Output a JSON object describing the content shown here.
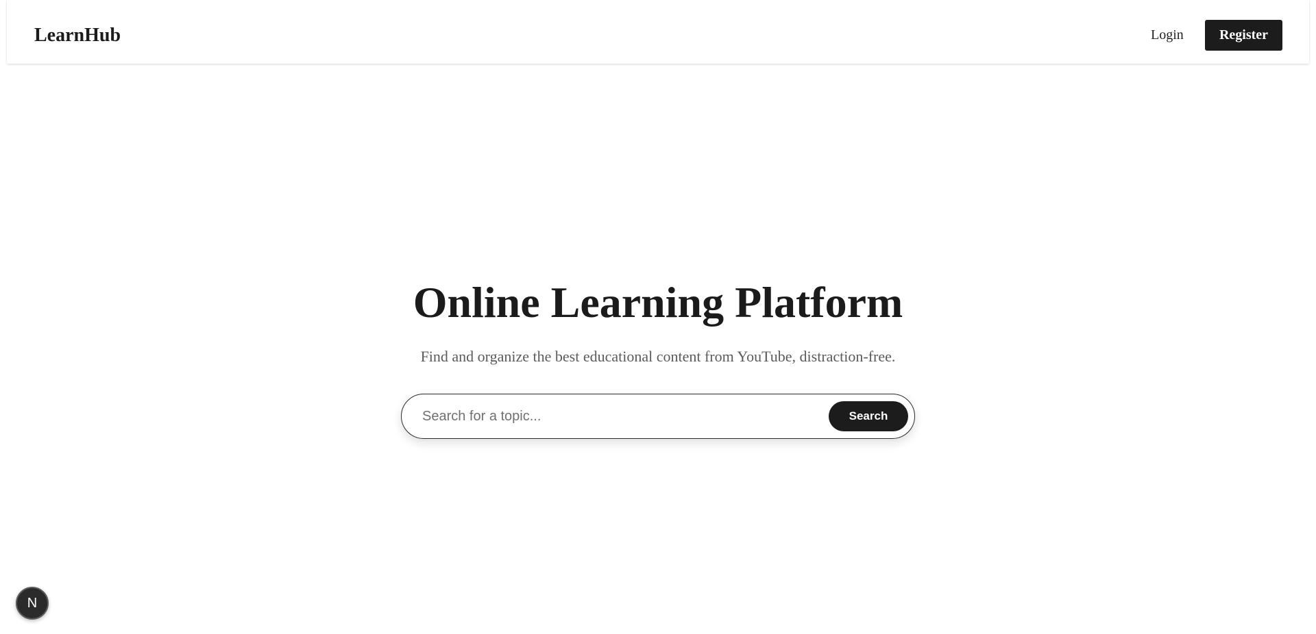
{
  "header": {
    "brand": "LearnHub",
    "login_label": "Login",
    "register_label": "Register"
  },
  "hero": {
    "title": "Online Learning Platform",
    "subtitle": "Find and organize the best educational content from YouTube, distraction-free."
  },
  "search": {
    "placeholder": "Search for a topic...",
    "value": "",
    "button_label": "Search"
  },
  "dev_badge": {
    "letter": "N",
    "icon": "nextjs-logo-icon"
  },
  "colors": {
    "primary": "#1c1c1c",
    "background": "#ffffff",
    "subtitle": "#5a5a5a"
  }
}
